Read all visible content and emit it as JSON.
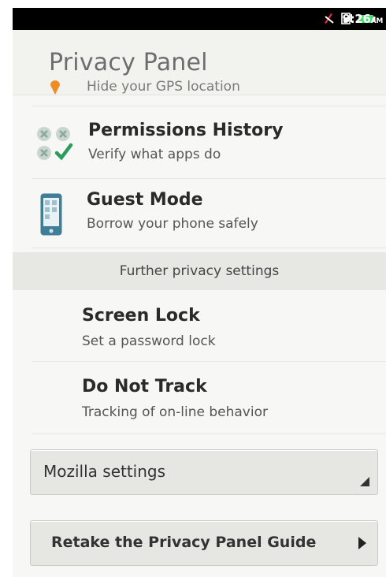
{
  "status_bar": {
    "time": "9:26",
    "ampm": "AM"
  },
  "header": {
    "title": "Privacy Panel"
  },
  "rows": {
    "gps": {
      "subtitle": "Hide your GPS location"
    },
    "permissions": {
      "title": "Permissions History",
      "subtitle": "Verify what apps do"
    },
    "guest": {
      "title": "Guest Mode",
      "subtitle": "Borrow your phone safely"
    }
  },
  "section_header": "Further privacy settings",
  "settings": {
    "screen_lock": {
      "title": "Screen Lock",
      "subtitle": "Set a password lock"
    },
    "do_not_track": {
      "title": "Do Not Track",
      "subtitle": "Tracking of on-line behavior"
    }
  },
  "mozilla_select": {
    "label": "Mozilla settings"
  },
  "retake_button": {
    "label": "Retake the Privacy Panel Guide"
  },
  "colors": {
    "accent_check": "#2a9d5c",
    "gps_pin": "#f08a24",
    "phone_icon": "#3f7e96"
  },
  "icons": [
    "wifi-icon",
    "sim-icon",
    "battery-icon",
    "location-pin-icon",
    "permissions-icon",
    "phone-icon",
    "chevron-right-icon",
    "dropdown-corner-icon"
  ]
}
